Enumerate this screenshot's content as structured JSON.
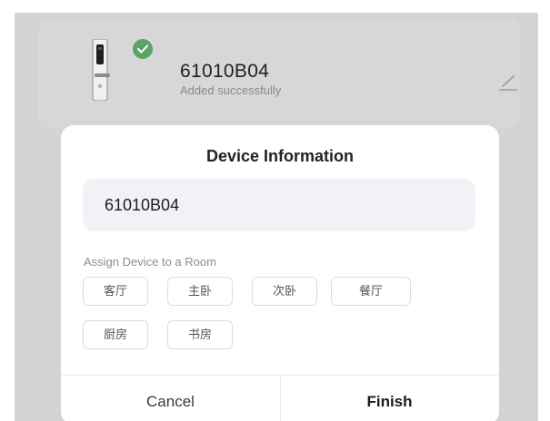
{
  "device": {
    "name": "61010B04",
    "status": "Added successfully",
    "icon": "smart-lock-icon",
    "badge_icon": "checkmark-icon",
    "edit_icon": "edit-pencil-icon"
  },
  "dialog": {
    "title": "Device Information",
    "name_field": {
      "value": "61010B04",
      "placeholder": ""
    },
    "room_section_label": "Assign Device to a Room",
    "rooms": [
      "客厅",
      "主卧",
      "次卧",
      "餐厅",
      "厨房",
      "书房"
    ],
    "cancel_label": "Cancel",
    "finish_label": "Finish"
  },
  "colors": {
    "overlay": "#d3d3d6",
    "success_badge": "#5aa565",
    "dialog_bg": "#ffffff",
    "field_bg": "#f1f2f6"
  }
}
